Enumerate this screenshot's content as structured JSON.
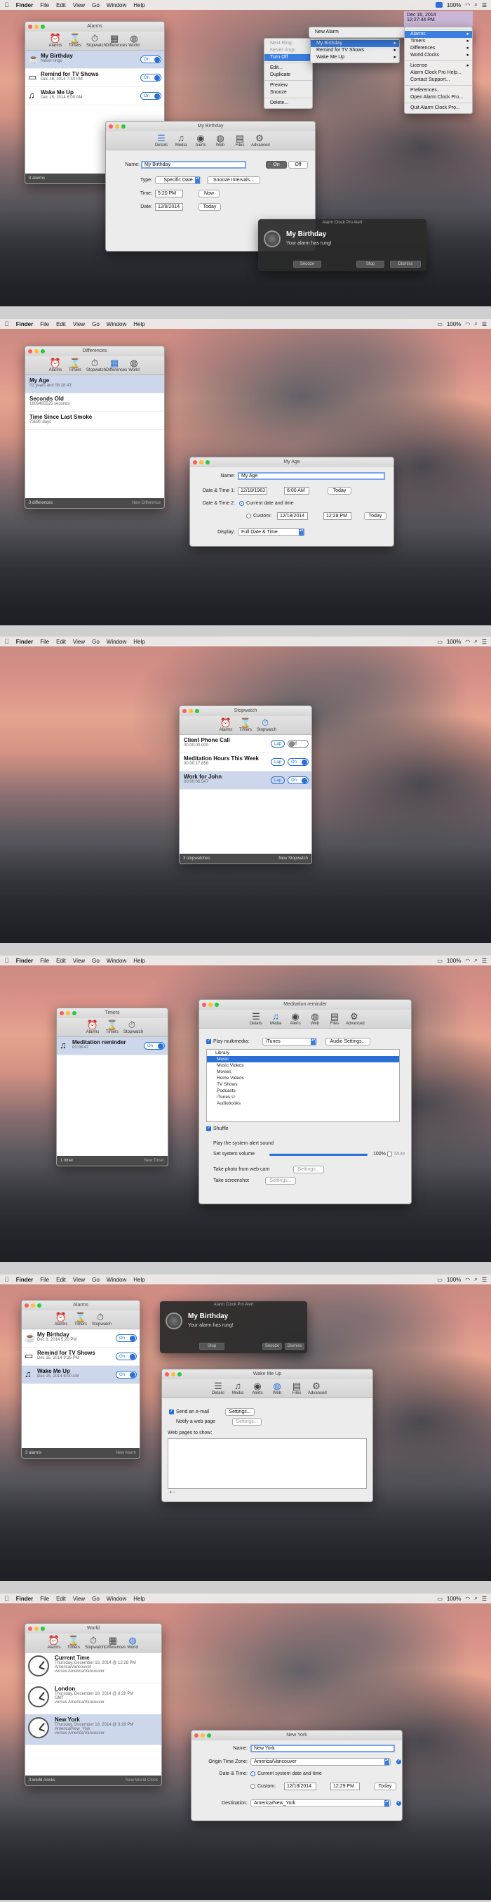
{
  "menubar": {
    "apple": "",
    "items": [
      "Finder",
      "File",
      "Edit",
      "View",
      "Go",
      "Window",
      "Help"
    ],
    "status": "100%",
    "wifi": "wifi-icon",
    "user": "user-icon",
    "search": "search-icon",
    "menu": "menu-list-icon"
  },
  "tools": {
    "alarms": "Alarms",
    "timers": "Timers",
    "stopwatch": "Stopwatch",
    "differences": "Differences",
    "world": "World",
    "details": "Details",
    "media": "Media",
    "alerts": "Alerts",
    "web": "Web",
    "files": "Files",
    "advanced": "Advanced"
  },
  "s1": {
    "alarms_title": "Alarms",
    "alarms": [
      {
        "name": "My Birthday",
        "sub": "Never rings",
        "toggle": "On"
      },
      {
        "name": "Remind for TV Shows",
        "sub": "Dec 16, 2014 7:30 PM",
        "toggle": "On"
      },
      {
        "name": "Wake Me Up",
        "sub": "Dec 15, 2014 6:00 AM",
        "toggle": "On"
      }
    ],
    "alarms_count": "3 alarms",
    "editor_title": "My Birthday",
    "name_label": "Name:",
    "name_value": "My Birthday",
    "on": "On",
    "off": "Off",
    "type_label": "Type:",
    "type_value": "Specific Date",
    "snooze": "Snooze Intervals...",
    "time_label": "Time:",
    "time_value": "5:20 PM",
    "now": "Now",
    "date_label": "Date:",
    "date_value": "12/8/2014",
    "today": "Today",
    "notif_title": "Alarm Clock Pro Alert",
    "notif_heading": "My Birthday",
    "notif_msg": "Your alarm has rung!",
    "notif_btns": [
      "Snooze",
      "Stop",
      "Dismiss"
    ],
    "ctx": [
      "Next Ring:",
      "Never rings",
      "Turn Off",
      "Edit...",
      "Duplicate",
      "Preview",
      "Snooze",
      "Delete..."
    ],
    "tray_date": "Dec 16, 2014",
    "tray_time": "12:27:44 PM",
    "tray_menu": [
      "New Alarm",
      "Alarms",
      "Timers",
      "Differences",
      "World Clocks",
      "License",
      "Alarm Clock Pro Help...",
      "Contact Support...",
      "Preferences...",
      "Open Alarm Clock Pro...",
      "Quit Alarm Clock Pro..."
    ],
    "sub_menu": [
      "My Birthday",
      "Remind for TV Shows",
      "Wake Me Up"
    ]
  },
  "s2": {
    "title": "Differences",
    "rows": [
      {
        "name": "My Age",
        "sub": "51 years and 08:28:43"
      },
      {
        "name": "Seconds Old",
        "sub": "1609465525 seconds"
      },
      {
        "name": "Time Since Last Smoke",
        "sub": "72630 days"
      }
    ],
    "count": "3 differences",
    "new_btn": "New Difference",
    "editor_title": "My Age",
    "name_label": "Name:",
    "name_value": "My Age",
    "dt1_label": "Date & Time 1:",
    "dt1_date": "12/18/1963",
    "dt1_time": "6:00 AM",
    "today": "Today",
    "dt2_label": "Date & Time 2:",
    "dt2_opt1": "Current date and time",
    "dt2_opt2": "Custom:",
    "dt2_date": "12/18/2014",
    "dt2_time": "12:28 PM",
    "today2": "Today",
    "display_label": "Display:",
    "display_value": "Full Date & Time"
  },
  "s3": {
    "title": "Stopwatch",
    "rows": [
      {
        "name": "Client Phone Call",
        "sub": "00:00:00.000",
        "lap": "Lap",
        "toggle": "Off"
      },
      {
        "name": "Meditation Hours This Week",
        "sub": "00:00:17.858",
        "lap": "Lap",
        "toggle": "On"
      },
      {
        "name": "Work for John",
        "sub": "00:00:06.547",
        "lap": "Lap",
        "toggle": "On"
      }
    ],
    "count": "3 stopwatches",
    "new_btn": "New Stopwatch"
  },
  "s4": {
    "title": "Timers",
    "rows": [
      {
        "name": "Meditation reminder",
        "sub": "00:08:47",
        "toggle": "On"
      }
    ],
    "count": "1 timer",
    "new_btn": "New Timer",
    "editor_title": "Meditation reminder",
    "play_label": "Play multimedia:",
    "source": "iTunes",
    "audio_settings": "Audio Settings...",
    "library": [
      "Library",
      "Music",
      "Music Videos",
      "Movies",
      "Home Videos",
      "TV Shows",
      "Podcasts",
      "iTunes U",
      "Audiobooks"
    ],
    "shuffle": "Shuffle",
    "system_alert": "Play the system alert sound",
    "volume_label": "Set system volume",
    "volume_value": "100%",
    "volume_level": 1.0,
    "mute": "Mute",
    "webcam": "Take photo from web cam",
    "webcam_settings": "Settings...",
    "screenshot": "Take screenshot",
    "screenshot_settings": "Settings..."
  },
  "s5": {
    "title": "Alarms",
    "alarms": [
      {
        "name": "My Birthday",
        "sub": "Dec 8, 2014 5:20 PM",
        "toggle": "On"
      },
      {
        "name": "Remind for TV Shows",
        "sub": "Dec 15, 2014 9:35 PM",
        "toggle": "On"
      },
      {
        "name": "Wake Me Up",
        "sub": "Dec 15, 2014 6:00 AM",
        "toggle": "On"
      }
    ],
    "count": "3 alarms",
    "new_btn": "New Alarm",
    "notif_title": "Alarm Clock Pro Alert",
    "notif_heading": "My Birthday",
    "notif_msg": "Your alarm has rung!",
    "notif_btns": [
      "Stop",
      "Snooze",
      "Dismiss"
    ],
    "editor_title": "Wake Me Up",
    "email_label": "Send an e-mail",
    "email_settings": "Settings...",
    "notify_label": "Notify a web page",
    "notify_settings": "Settings...",
    "pages_label": "Web pages to show:",
    "list_controls": "+  -"
  },
  "s6": {
    "title": "World",
    "rows": [
      {
        "name": "Current Time",
        "l1": "Thursday, December 18, 2014 @ 12:28 PM",
        "l2": "America/Vancouver",
        "l3": "versus America/Vancouver"
      },
      {
        "name": "London",
        "l1": "Thursday, December 18, 2014 @ 8:28 PM",
        "l2": "GMT",
        "l3": "versus America/Vancouver"
      },
      {
        "name": "New York",
        "l1": "Thursday, December 18, 2014 @ 3:28 PM",
        "l2": "America/New_York",
        "l3": "versus America/Vancouver"
      }
    ],
    "count": "3 world clocks",
    "new_btn": "New World Clock",
    "editor_title": "New York",
    "name_label": "Name:",
    "name_value": "New York",
    "origin_label": "Origin Time Zone:",
    "origin_value": "America/Vancouver",
    "dt_label": "Date & Time:",
    "dt_opt1": "Current system date and time",
    "dt_opt2": "Custom:",
    "dt_date": "12/18/2014",
    "dt_time": "12:29 PM",
    "today": "Today",
    "dest_label": "Destination:",
    "dest_value": "America/New_York"
  }
}
